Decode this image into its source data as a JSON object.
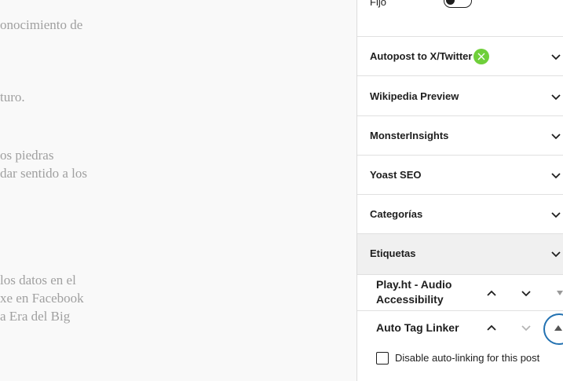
{
  "editor": {
    "fragments": [
      "onocimiento de",
      "turo.",
      "os piedras",
      "dar sentido a los",
      " los datos en el",
      "xe en Facebook",
      "a Era del Big"
    ]
  },
  "sidebar": {
    "sticky_label": "Fijo",
    "sticky_enabled": false,
    "panels": [
      {
        "title": "Autopost to X/Twitter",
        "icon": "x-twitter-icon",
        "badge_color": "#6fcf3a"
      },
      {
        "title": "Wikipedia Preview"
      },
      {
        "title": "MonsterInsights"
      },
      {
        "title": "Yoast SEO"
      },
      {
        "title": "Categorías"
      },
      {
        "title": "Etiquetas"
      }
    ],
    "metaboxes": [
      {
        "title_line1": "Play.ht - Audio",
        "title_line2": "Accessibility"
      },
      {
        "title": "Auto Tag Linker"
      }
    ],
    "auto_tag_linker": {
      "checkbox_label": "Disable auto-linking for this post",
      "checked": false
    }
  },
  "colors": {
    "accent": "#2271b1",
    "x_badge": "#6fcf3a",
    "text": "#1e1e1e",
    "muted_text": "#a0a0a0"
  }
}
